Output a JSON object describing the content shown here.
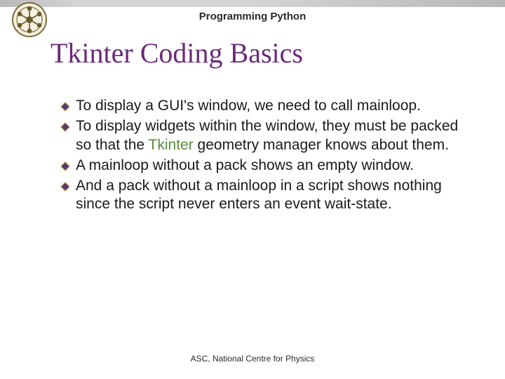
{
  "header": {
    "course_title": "Programming Python"
  },
  "slide": {
    "title": "Tkinter Coding Basics"
  },
  "bullets": [
    {
      "pre": "To display a GUI's window, we need to call mainloop.",
      "hl": "",
      "post": ""
    },
    {
      "pre": "To display widgets within the window, they must be packed so that the ",
      "hl": "Tkinter",
      "post": " geometry manager knows about them."
    },
    {
      "pre": "A mainloop without a pack shows an empty window.",
      "hl": "",
      "post": ""
    },
    {
      "pre": "And a pack without a mainloop in a script shows nothing since the script never enters an event wait-state.",
      "hl": "",
      "post": ""
    }
  ],
  "footer": {
    "text": "ASC, National Centre for Physics"
  },
  "icons": {
    "logo": "institution-seal-icon",
    "bullet": "diamond-bullet-icon"
  }
}
